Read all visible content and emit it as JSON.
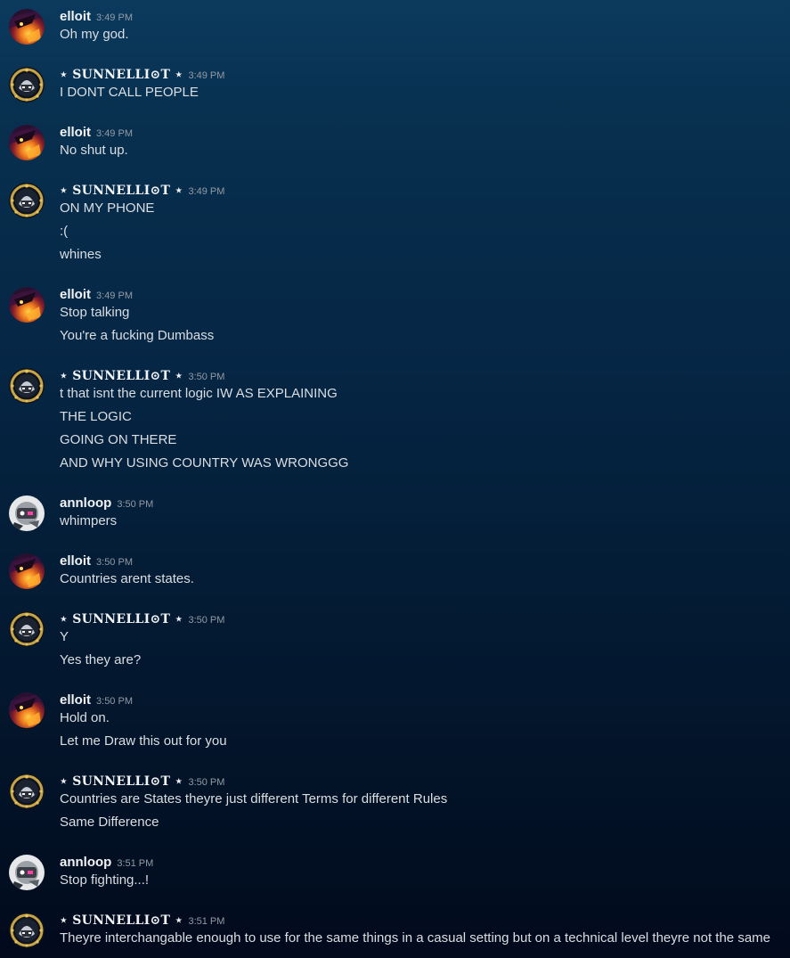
{
  "messages": [
    {
      "author": "elloit",
      "avatar": "elloit",
      "time": "3:49 PM",
      "lines": [
        "Oh my god."
      ]
    },
    {
      "author": "⋆ SUNNELLI⊙T ⋆",
      "avatar": "sunnelliot",
      "time": "3:49 PM",
      "lines": [
        "I  DONT CALL PEOPLE"
      ]
    },
    {
      "author": "elloit",
      "avatar": "elloit",
      "time": "3:49 PM",
      "lines": [
        "No shut up."
      ]
    },
    {
      "author": "⋆ SUNNELLI⊙T ⋆",
      "avatar": "sunnelliot",
      "time": "3:49 PM",
      "lines": [
        "ON MY PHONE",
        ":(",
        "whines"
      ]
    },
    {
      "author": "elloit",
      "avatar": "elloit",
      "time": "3:49 PM",
      "lines": [
        "Stop talking",
        "You're a fucking Dumbass"
      ]
    },
    {
      "author": "⋆ SUNNELLI⊙T ⋆",
      "avatar": "sunnelliot",
      "time": "3:50 PM",
      "lines": [
        "t that isnt the current logic IW AS EXPLAINING",
        "THE LOGIC",
        "GOING ON THERE",
        "AND WHY USING COUNTRY WAS WRONGGG"
      ]
    },
    {
      "author": "annloop",
      "avatar": "annloop",
      "time": "3:50 PM",
      "lines": [
        "whimpers"
      ]
    },
    {
      "author": "elloit",
      "avatar": "elloit",
      "time": "3:50 PM",
      "lines": [
        "Countries arent states."
      ]
    },
    {
      "author": "⋆ SUNNELLI⊙T ⋆",
      "avatar": "sunnelliot",
      "time": "3:50 PM",
      "lines": [
        "Y",
        "Yes they are?"
      ]
    },
    {
      "author": "elloit",
      "avatar": "elloit",
      "time": "3:50 PM",
      "lines": [
        "Hold on.",
        "Let me Draw this out for you"
      ]
    },
    {
      "author": "⋆ SUNNELLI⊙T ⋆",
      "avatar": "sunnelliot",
      "time": "3:50 PM",
      "lines": [
        "Countries are States theyre just different Terms for different Rules",
        "Same Difference"
      ]
    },
    {
      "author": "annloop",
      "avatar": "annloop",
      "time": "3:51 PM",
      "lines": [
        "Stop fighting...!"
      ]
    },
    {
      "author": "⋆ SUNNELLI⊙T ⋆",
      "avatar": "sunnelliot",
      "time": "3:51 PM",
      "lines": [
        "Theyre interchangable enough to use for the same things in a casual setting but on a technical level theyre not the same"
      ]
    }
  ]
}
